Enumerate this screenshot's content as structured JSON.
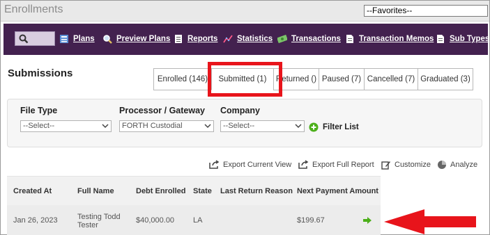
{
  "app": {
    "title": "Enrollments",
    "favorites_value": "--Favorites--"
  },
  "nav": {
    "items": [
      {
        "label": "Plans",
        "icon": "book-icon"
      },
      {
        "label": "Preview Plans",
        "icon": "magnifier-icon"
      },
      {
        "label": "Reports",
        "icon": "report-icon"
      },
      {
        "label": "Statistics",
        "icon": "line-chart-icon"
      },
      {
        "label": "Transactions",
        "icon": "money-icon"
      },
      {
        "label": "Transaction Memos",
        "icon": "document-icon"
      },
      {
        "label": "Sub Types",
        "icon": "document-icon"
      }
    ]
  },
  "page": {
    "section_title": "Submissions"
  },
  "tabs": [
    {
      "label": "Enrolled (146)"
    },
    {
      "label": "Submitted (1)",
      "active": true
    },
    {
      "label": "Returned ()"
    },
    {
      "label": "Paused (7)"
    },
    {
      "label": "Cancelled (7)"
    },
    {
      "label": "Graduated (3)"
    }
  ],
  "filters": {
    "file_type_label": "File Type",
    "file_type_value": "--Select--",
    "processor_label": "Processor / Gateway",
    "processor_value": "FORTH Custodial",
    "company_label": "Company",
    "company_value": "--Select--",
    "filter_button": "Filter List"
  },
  "toolbar": {
    "export_current": "Export Current View",
    "export_full": "Export Full Report",
    "customize": "Customize",
    "analyze": "Analyze"
  },
  "table": {
    "headers": [
      "Created At",
      "Full Name",
      "Debt Enrolled",
      "State",
      "Last Return Reason",
      "Next Payment Amount"
    ],
    "rows": [
      {
        "created_at": "Jan 26, 2023",
        "full_name_line1": "Testing Todd",
        "full_name_line2": "Tester",
        "debt_enrolled": "$40,000.00",
        "state": "LA",
        "last_return_reason": "",
        "next_payment": "$199.67"
      }
    ]
  },
  "colors": {
    "nav_bg": "#43214f",
    "highlight": "#e8141b",
    "arrow": "#e8141b",
    "go_arrow": "#4caf1a"
  }
}
